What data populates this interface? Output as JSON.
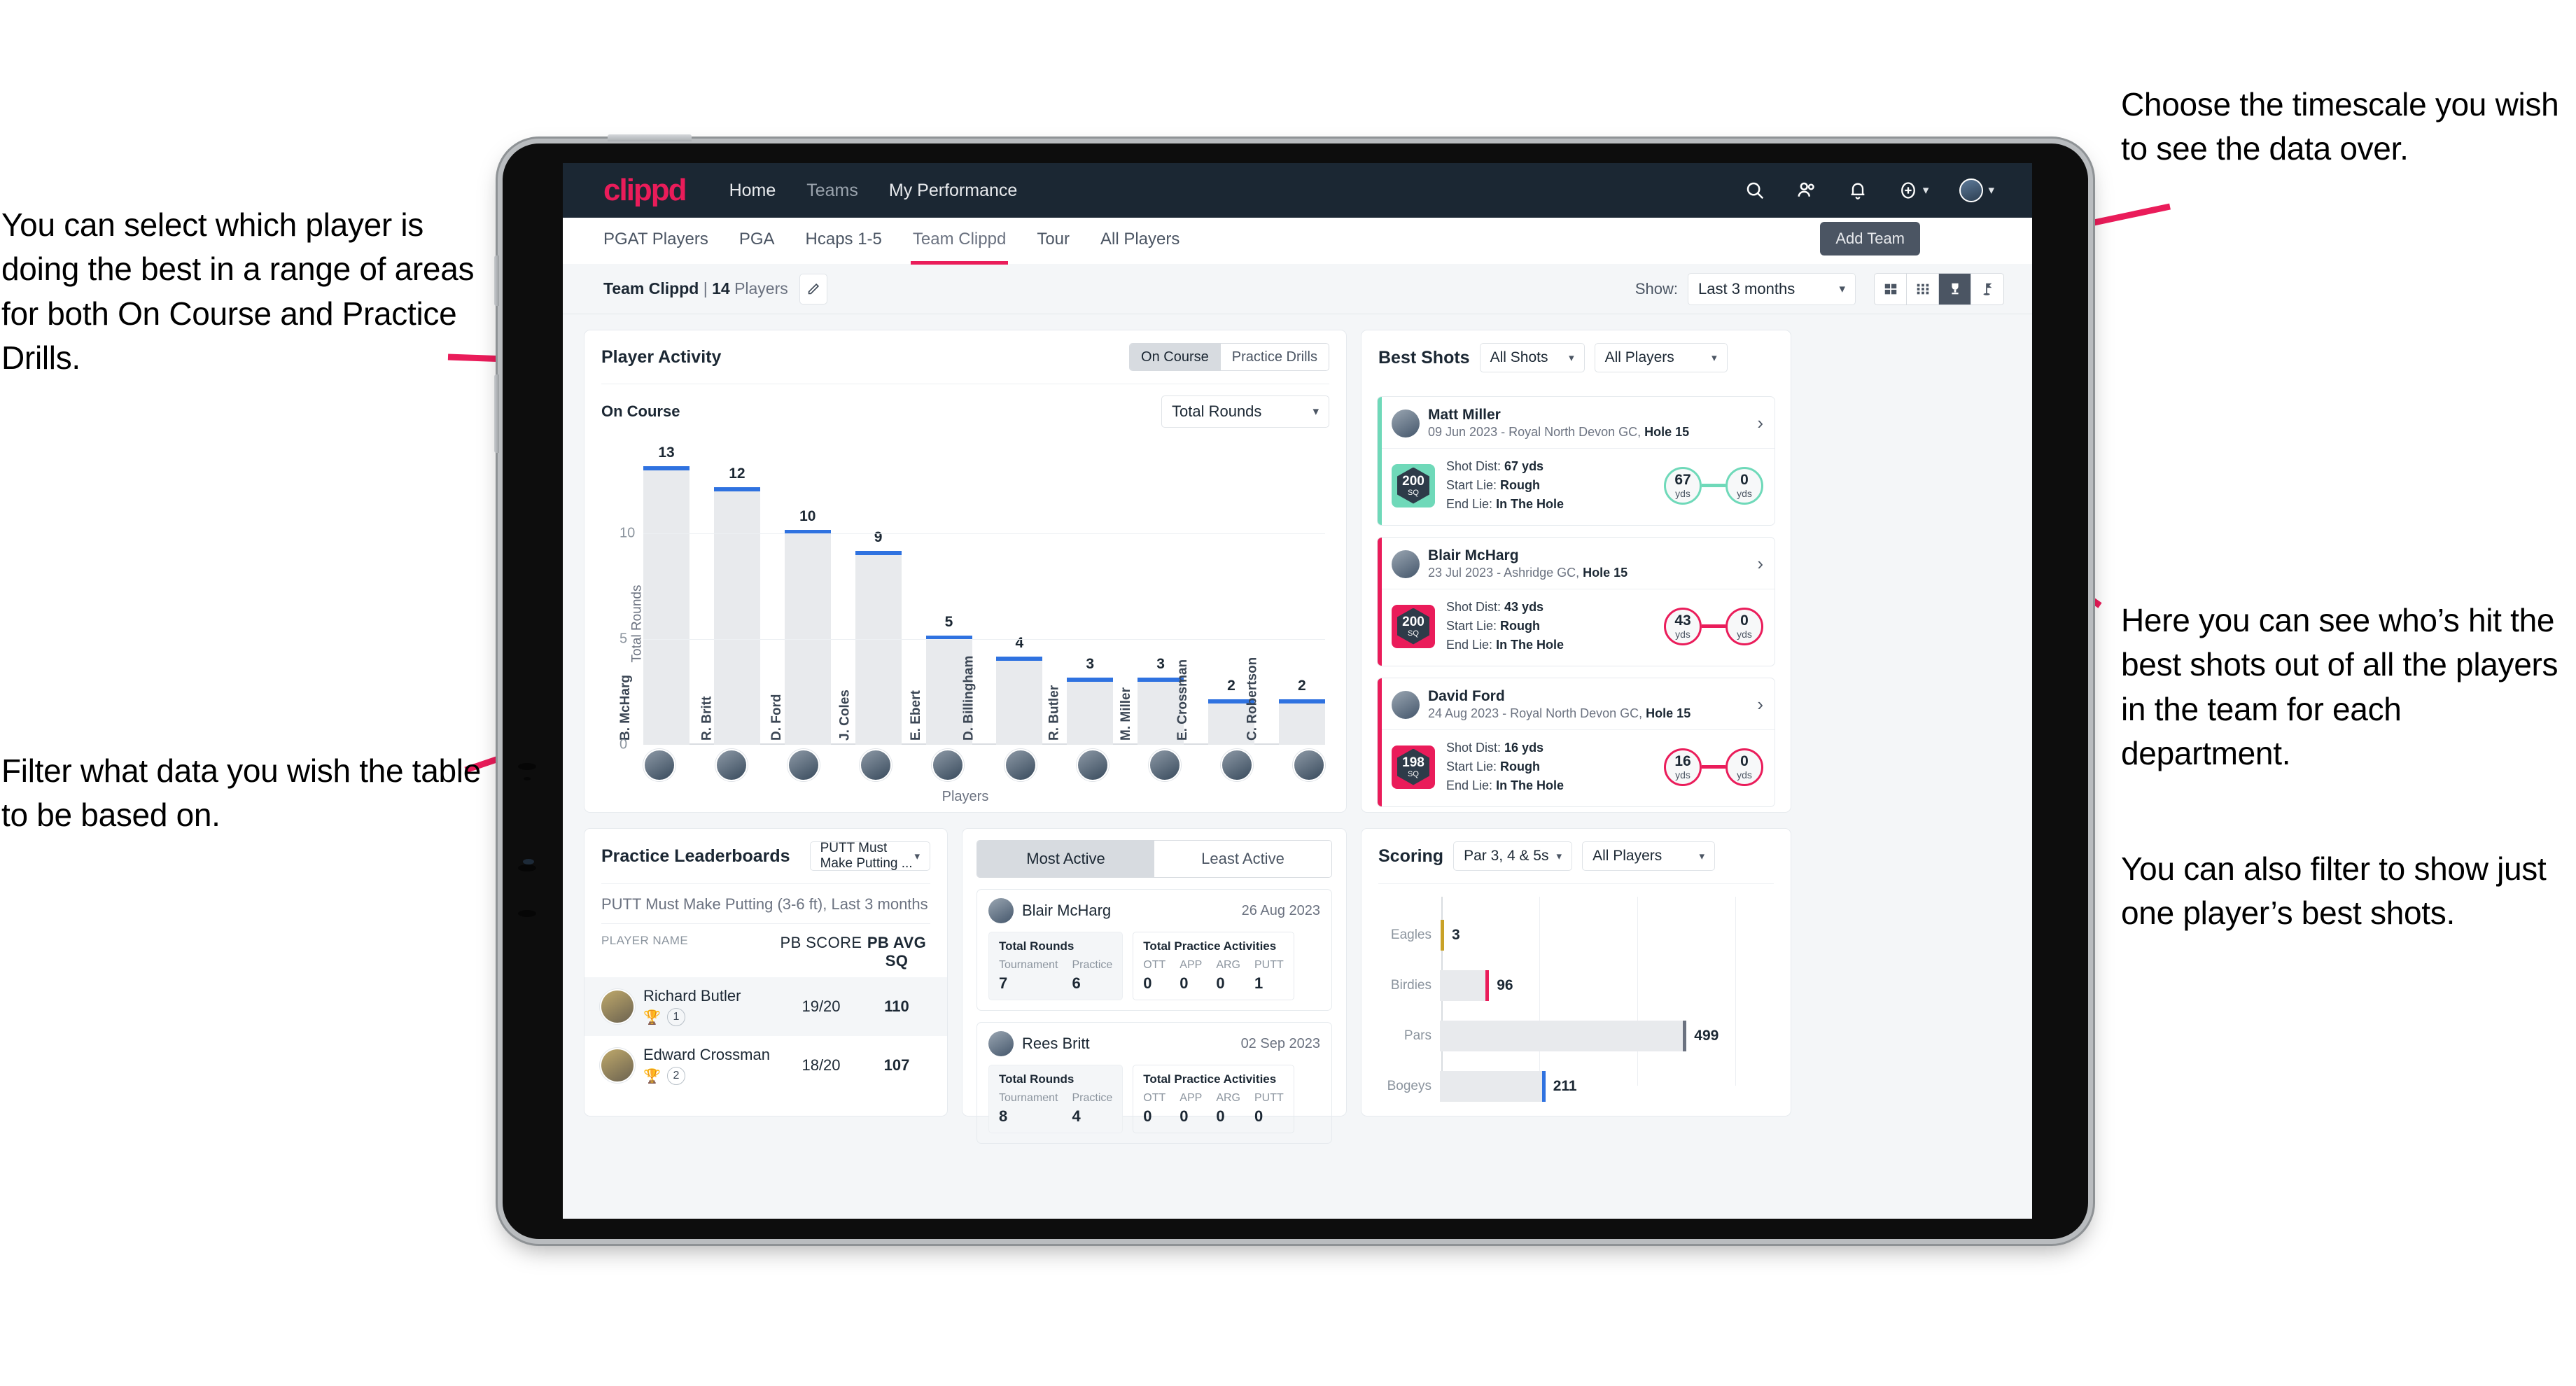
{
  "annotations": {
    "left_top": "You can select which player is doing the best in a range of areas for both On Course and Practice Drills.",
    "left_bottom": "Filter what data you wish the table to be based on.",
    "right_top": "Choose the timescale you wish to see the data over.",
    "right_middle": "Here you can see who’s hit the best shots out of all the players in the team for each department.",
    "right_bottom": "You can also filter to show just one player’s best shots."
  },
  "topnav": {
    "logo": "clippd",
    "links": [
      "Home",
      "Teams",
      "My Performance"
    ],
    "icons": [
      "search-icon",
      "people-icon",
      "bell-icon",
      "plus-circle-icon",
      "avatar"
    ]
  },
  "tabs": {
    "items": [
      "PGAT Players",
      "PGA",
      "Hcaps 1-5",
      "Team Clippd",
      "Tour",
      "All Players"
    ],
    "active": "Team Clippd",
    "tooltip": "Add Team"
  },
  "subbar": {
    "team_name": "Team Clippd",
    "team_separator": " | ",
    "team_count": "14",
    "team_players_word": "Players",
    "edit_icon": "pencil-icon",
    "show_label": "Show:",
    "show_value": "Last 3 months",
    "view_buttons": [
      "cards-view-icon",
      "grid-view-icon",
      "trophy-view-icon",
      "flag-view-icon"
    ],
    "view_active_index": 2
  },
  "player_activity": {
    "title": "Player Activity",
    "segments": [
      "On Course",
      "Practice Drills"
    ],
    "segment_active": "On Course",
    "sub_title": "On Course",
    "metric_select": "Total Rounds"
  },
  "chart_data": [
    {
      "type": "bar",
      "title": "Player Activity — On Course",
      "xlabel": "Players",
      "ylabel": "Total Rounds",
      "categories": [
        "B. McHarg",
        "R. Britt",
        "D. Ford",
        "J. Coles",
        "E. Ebert",
        "D. Billingham",
        "R. Butler",
        "M. Miller",
        "E. Crossman",
        "C. Robertson"
      ],
      "values": [
        13,
        12,
        10,
        9,
        5,
        4,
        3,
        3,
        2,
        2
      ],
      "ylim": [
        0,
        14
      ],
      "yticks": [
        0,
        5,
        10
      ],
      "grid": true,
      "bar_color": "#e8eaed",
      "cap_color": "#2f72e0"
    },
    {
      "type": "bar",
      "orientation": "horizontal",
      "title": "Scoring",
      "categories": [
        "Eagles",
        "Birdies",
        "Pars",
        "Bogeys"
      ],
      "values": [
        3,
        96,
        499,
        211
      ],
      "colors": [
        "#c9a227",
        "#ea1c5a",
        "#6b7280",
        "#2f72e0"
      ],
      "xlim": [
        0,
        600
      ],
      "grid": true
    }
  ],
  "best_shots": {
    "title": "Best Shots",
    "shot_filter": "All Shots",
    "player_filter": "All Players",
    "items": [
      {
        "name": "Matt Miller",
        "meta_prefix": "09 Jun 2023 - Royal North Devon GC, ",
        "meta_hole": "Hole 15",
        "score": "200",
        "score_unit": "SQ",
        "accent": "#6fd9b9",
        "shot_dist_label": "Shot Dist: ",
        "shot_dist": "67 yds",
        "start_lie_label": "Start Lie: ",
        "start_lie": "Rough",
        "end_lie_label": "End Lie: ",
        "end_lie": "In The Hole",
        "from_val": "67",
        "from_unit": "yds",
        "to_val": "0",
        "to_unit": "yds"
      },
      {
        "name": "Blair McHarg",
        "meta_prefix": "23 Jul 2023 - Ashridge GC, ",
        "meta_hole": "Hole 15",
        "score": "200",
        "score_unit": "SQ",
        "accent": "#ea1c5a",
        "shot_dist_label": "Shot Dist: ",
        "shot_dist": "43 yds",
        "start_lie_label": "Start Lie: ",
        "start_lie": "Rough",
        "end_lie_label": "End Lie: ",
        "end_lie": "In The Hole",
        "from_val": "43",
        "from_unit": "yds",
        "to_val": "0",
        "to_unit": "yds"
      },
      {
        "name": "David Ford",
        "meta_prefix": "24 Aug 2023 - Royal North Devon GC, ",
        "meta_hole": "Hole 15",
        "score": "198",
        "score_unit": "SQ",
        "accent": "#ea1c5a",
        "shot_dist_label": "Shot Dist: ",
        "shot_dist": "16 yds",
        "start_lie_label": "Start Lie: ",
        "start_lie": "Rough",
        "end_lie_label": "End Lie: ",
        "end_lie": "In The Hole",
        "from_val": "16",
        "from_unit": "yds",
        "to_val": "0",
        "to_unit": "yds"
      }
    ]
  },
  "practice_leaderboards": {
    "title": "Practice Leaderboards",
    "drill_select": "PUTT Must Make Putting ...",
    "subtitle_bold": "PUTT Must Make Putting (3-6 ft),",
    "subtitle_light": " Last 3 months",
    "columns": [
      "PLAYER NAME",
      "PB SCORE",
      "PB AVG SQ"
    ],
    "rows": [
      {
        "name": "Richard Butler",
        "rank": "1",
        "trophy": "gold",
        "pb_score": "19/20",
        "pb_avg_sq": "110"
      },
      {
        "name": "Edward Crossman",
        "rank": "2",
        "trophy": "silver",
        "pb_score": "18/20",
        "pb_avg_sq": "107"
      }
    ]
  },
  "activity": {
    "tabs": [
      "Most Active",
      "Least Active"
    ],
    "active_tab": "Most Active",
    "rounds_label": "Total Rounds",
    "rounds_cols": [
      "Tournament",
      "Practice"
    ],
    "practice_label": "Total Practice Activities",
    "practice_cols": [
      "OTT",
      "APP",
      "ARG",
      "PUTT"
    ],
    "items": [
      {
        "name": "Blair McHarg",
        "date": "26 Aug 2023",
        "tournament": "7",
        "practice": "6",
        "ott": "0",
        "app": "0",
        "arg": "0",
        "putt": "1"
      },
      {
        "name": "Rees Britt",
        "date": "02 Sep 2023",
        "tournament": "8",
        "practice": "4",
        "ott": "0",
        "app": "0",
        "arg": "0",
        "putt": "0"
      }
    ]
  },
  "scoring": {
    "title": "Scoring",
    "par_filter": "Par 3, 4 & 5s",
    "player_filter": "All Players"
  },
  "colors": {
    "brand": "#ea1c5a",
    "nav_bg": "#1b2733",
    "page_bg": "#f4f6f8",
    "bar": "#e8eaed",
    "bar_cap": "#2f72e0"
  }
}
